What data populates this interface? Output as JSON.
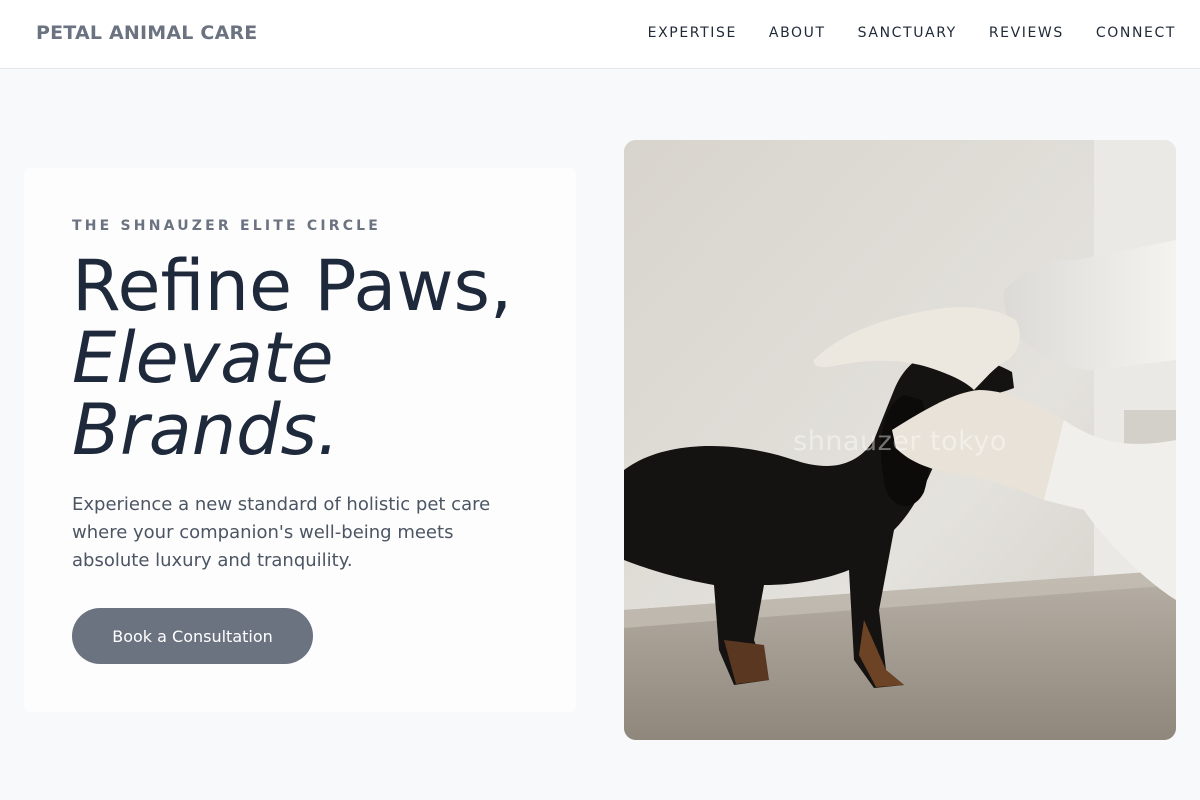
{
  "header": {
    "brand": "PETAL ANIMAL CARE",
    "nav": [
      "EXPERTISE",
      "ABOUT",
      "SANCTUARY",
      "REVIEWS",
      "CONNECT"
    ]
  },
  "hero": {
    "kicker": "THE SHNAUZER ELITE CIRCLE",
    "headline_line1": "Refine Paws,",
    "headline_line2": "Elevate",
    "headline_line3": "Brands.",
    "lead": "Experience a new standard of holistic pet care where your companion's well-being meets absolute luxury and tranquility.",
    "cta_label": "Book a Consultation"
  },
  "image": {
    "watermark": "shnauzer tokyo"
  },
  "colors": {
    "background": "#f8f9fb",
    "brand": "#6b7280",
    "button": "#6b7280",
    "heading": "#1e293b"
  }
}
